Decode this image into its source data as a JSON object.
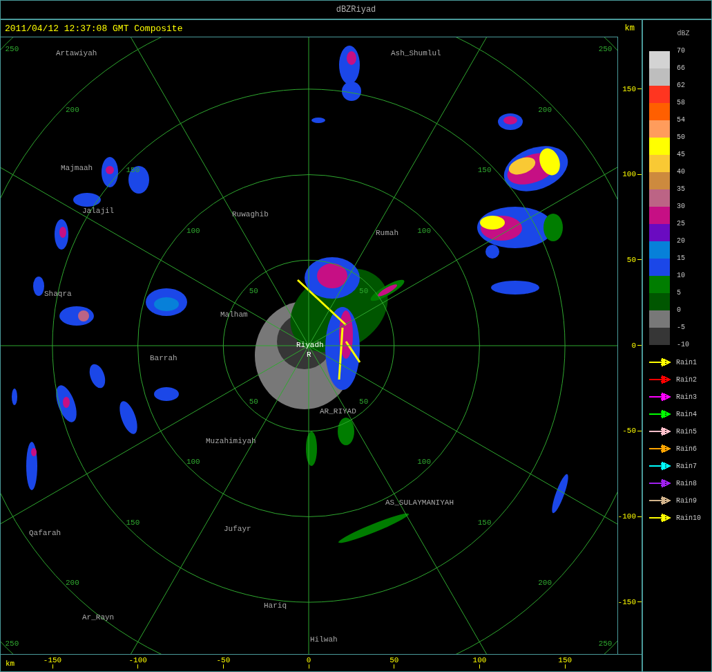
{
  "window": {
    "title": "dBZRiyad"
  },
  "header": {
    "timestamp": "2011/04/12 12:37:08 GMT Composite",
    "unit": "km"
  },
  "rings": [
    {
      "labels": [
        "50",
        "50",
        "50",
        "50"
      ]
    },
    {
      "labels": [
        "100",
        "100",
        "100",
        "100"
      ]
    },
    {
      "labels": [
        "150",
        "150",
        "150",
        "150"
      ]
    },
    {
      "labels": [
        "200",
        "200",
        "200",
        "200"
      ]
    },
    {
      "labels": [
        "250",
        "250",
        "250",
        "250"
      ]
    }
  ],
  "places": [
    {
      "name": "Artawiyah",
      "kind": "town"
    },
    {
      "name": "Ash_Shumlul",
      "kind": "town"
    },
    {
      "name": "Majmaah",
      "kind": "town"
    },
    {
      "name": "Jalajil",
      "kind": "town"
    },
    {
      "name": "Ruwaghib",
      "kind": "town"
    },
    {
      "name": "Rumah",
      "kind": "town"
    },
    {
      "name": "Shaqra",
      "kind": "town"
    },
    {
      "name": "Malham",
      "kind": "town"
    },
    {
      "name": "Barrah",
      "kind": "town"
    },
    {
      "name": "Riyadh",
      "kind": "radar"
    },
    {
      "name": "R",
      "kind": "radar"
    },
    {
      "name": "AR_RIYAD",
      "kind": "town"
    },
    {
      "name": "Muzahimiyah",
      "kind": "town"
    },
    {
      "name": "AS_SULAYMANIYAH",
      "kind": "town"
    },
    {
      "name": "Qafarah",
      "kind": "town"
    },
    {
      "name": "Jufayr",
      "kind": "town"
    },
    {
      "name": "Ar_Rayn",
      "kind": "town"
    },
    {
      "name": "Hariq",
      "kind": "town"
    },
    {
      "name": "Hilwah",
      "kind": "town"
    }
  ],
  "y_axis": {
    "ticks": [
      "150",
      "100",
      "50",
      "0",
      "-50",
      "-100",
      "-150"
    ]
  },
  "x_axis": {
    "unit": "km",
    "ticks": [
      "-150",
      "-100",
      "-50",
      "0",
      "50",
      "100",
      "150"
    ]
  },
  "legend": {
    "title": "dBZ",
    "scale_labels": [
      "70",
      "66",
      "62",
      "58",
      "54",
      "50",
      "45",
      "40",
      "35",
      "30",
      "25",
      "20",
      "15",
      "10",
      "5",
      "0",
      "-5",
      "-10"
    ],
    "bands": [
      {
        "color": "#d3d3d3"
      },
      {
        "color": "#bebebe"
      },
      {
        "color": "#ff3520"
      },
      {
        "color": "#ff5f00"
      },
      {
        "color": "#ff9c5c"
      },
      {
        "color": "#ffff00"
      },
      {
        "color": "#f9c934"
      },
      {
        "color": "#cd8a3e"
      },
      {
        "color": "#bc6485"
      },
      {
        "color": "#c60f84"
      },
      {
        "color": "#6a0bc1"
      },
      {
        "color": "#0780d9"
      },
      {
        "color": "#1b47e8"
      },
      {
        "color": "#007d00"
      },
      {
        "color": "#005600"
      },
      {
        "color": "#787878"
      },
      {
        "color": "#363636"
      }
    ],
    "tracks": [
      {
        "label": "Rain1",
        "color": "#ffff00"
      },
      {
        "label": "Rain2",
        "color": "#ff0000"
      },
      {
        "label": "Rain3",
        "color": "#ff00ff"
      },
      {
        "label": "Rain4",
        "color": "#00ff00"
      },
      {
        "label": "Rain5",
        "color": "#ffc0cb"
      },
      {
        "label": "Rain6",
        "color": "#ffa500"
      },
      {
        "label": "Rain7",
        "color": "#00ffff"
      },
      {
        "label": "Rain8",
        "color": "#a020f0"
      },
      {
        "label": "Rain9",
        "color": "#d2b48c"
      },
      {
        "label": "Rain10",
        "color": "#ffff00"
      }
    ]
  }
}
